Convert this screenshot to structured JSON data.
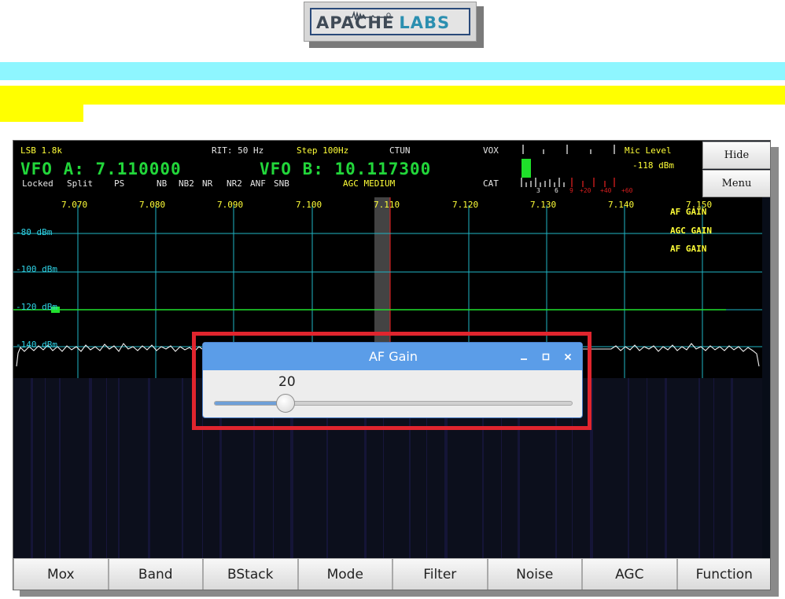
{
  "logo": {
    "part1": "APACHE",
    "part2": "LABS"
  },
  "header": {
    "mode_filter": "LSB 1.8k",
    "rit": "RIT: 50 Hz",
    "step": "Step 100Hz",
    "ctun": "CTUN",
    "vox": "VOX",
    "mic_level": "Mic Level",
    "signal_level": "-118 dBm",
    "vfo_a": "VFO A: 7.110000",
    "vfo_b": "VFO B: 10.117300",
    "agc": "AGC MEDIUM",
    "cat": "CAT",
    "meter_scale": [
      "3",
      "6",
      "9",
      "+20",
      "+40",
      "+60"
    ],
    "status": [
      "Locked",
      "Split",
      "PS",
      "NB",
      "NB2",
      "NR",
      "NR2",
      "ANF",
      "SNB"
    ]
  },
  "side_buttons": {
    "hide": "Hide",
    "menu": "Menu"
  },
  "spectrum": {
    "freq_labels": [
      "7.070",
      "7.080",
      "7.090",
      "7.100",
      "7.110",
      "7.120",
      "7.130",
      "7.140",
      "7.150"
    ],
    "dbm_labels": [
      "-80 dBm",
      "-100 dBm",
      "-120 dBm",
      "-140 dBm"
    ],
    "notes": [
      "AF GAIN",
      "AGC GAIN",
      "AF GAIN"
    ]
  },
  "dialog": {
    "title": "AF Gain",
    "value": "20",
    "level": 0.2,
    "minimize_icon": "minimize-icon",
    "maximize_icon": "maximize-icon",
    "close_icon": "close-icon"
  },
  "bottom_buttons": [
    "Mox",
    "Band",
    "BStack",
    "Mode",
    "Filter",
    "Noise",
    "AGC",
    "Function"
  ],
  "colors": {
    "vfo_green": "#22d63a",
    "highlight_red": "#e0252e",
    "dialog_titlebar": "#5b9de8",
    "grid_cyan": "#1fb6c6",
    "cyan_band": "#8ef6ff",
    "yellow_band": "#ffff00"
  }
}
